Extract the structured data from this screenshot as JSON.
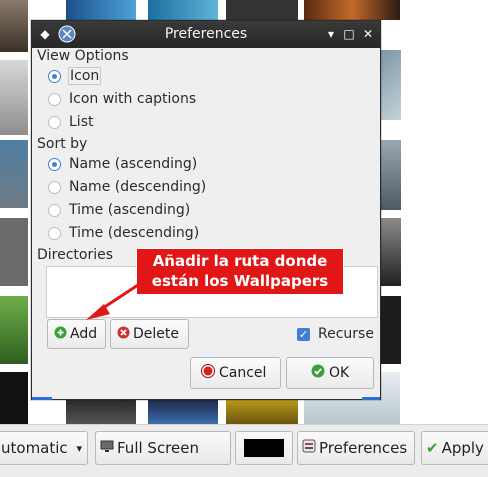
{
  "dialog": {
    "title": "Preferences",
    "view_options": {
      "label": "View Options",
      "options": [
        "Icon",
        "Icon with captions",
        "List"
      ],
      "selected": "Icon"
    },
    "sort_by": {
      "label": "Sort by",
      "options": [
        "Name (ascending)",
        "Name (descending)",
        "Time (ascending)",
        "Time (descending)"
      ],
      "selected": "Name (ascending)"
    },
    "directories_label": "Directories",
    "add_label": "Add",
    "delete_label": "Delete",
    "recurse_label": "Recurse",
    "recurse_checked": true,
    "cancel_label": "Cancel",
    "ok_label": "OK"
  },
  "annotation": {
    "line1": "Añadir la ruta donde",
    "line2": "están los Wallpapers",
    "color": "#e11717"
  },
  "toolbar": {
    "mode_label": "utomatic",
    "fullscreen_label": "Full Screen",
    "color_swatch": "#000000",
    "preferences_label": "Preferences",
    "apply_label": "Apply"
  },
  "colors": {
    "accent": "#3f7fd8",
    "titlebar": "#2b2b2b"
  }
}
